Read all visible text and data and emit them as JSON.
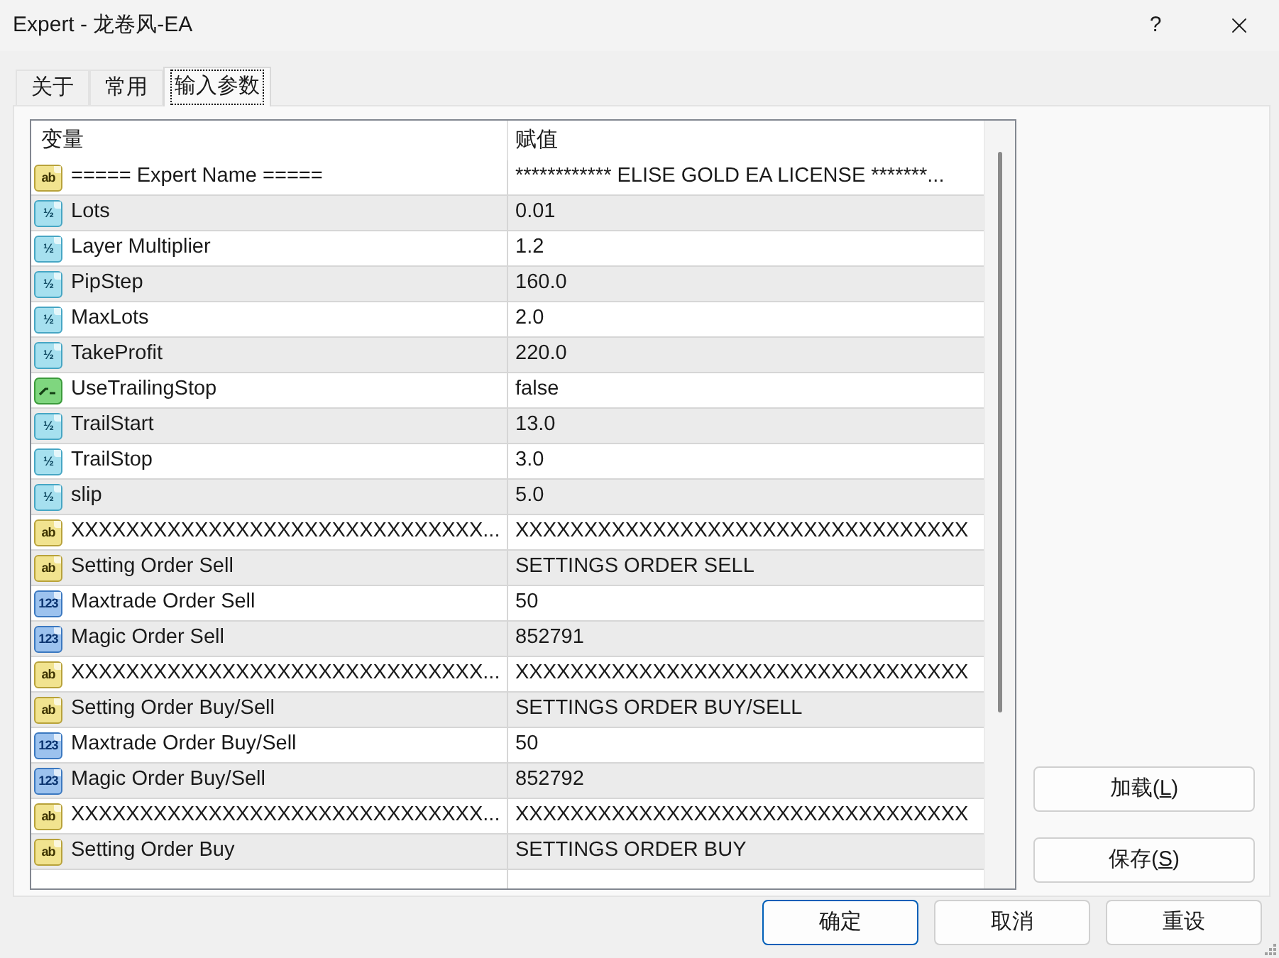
{
  "window": {
    "title": "Expert - 龙卷风-EA",
    "help_button": "?"
  },
  "tabs": [
    {
      "label": "关于",
      "selected": false
    },
    {
      "label": "常用",
      "selected": false
    },
    {
      "label": "输入参数",
      "selected": true
    }
  ],
  "parameters": {
    "columns": [
      "变量",
      "赋值"
    ],
    "rows": [
      {
        "kind": "string",
        "type_mark": "ab",
        "name": "===== Expert Name =====",
        "value": "************ ELISE GOLD EA LICENSE *******..."
      },
      {
        "kind": "double",
        "type_mark": "½",
        "name": "Lots",
        "value": "0.01"
      },
      {
        "kind": "double",
        "type_mark": "½",
        "name": "Layer Multiplier",
        "value": "1.2"
      },
      {
        "kind": "double",
        "type_mark": "½",
        "name": "PipStep",
        "value": "160.0"
      },
      {
        "kind": "double",
        "type_mark": "½",
        "name": "MaxLots",
        "value": "2.0"
      },
      {
        "kind": "double",
        "type_mark": "½",
        "name": "TakeProfit",
        "value": "220.0"
      },
      {
        "kind": "bool",
        "name": "UseTrailingStop",
        "value": "false"
      },
      {
        "kind": "double",
        "type_mark": "½",
        "name": "TrailStart",
        "value": "13.0"
      },
      {
        "kind": "double",
        "type_mark": "½",
        "name": "TrailStop",
        "value": "3.0"
      },
      {
        "kind": "double",
        "type_mark": "½",
        "name": "slip",
        "value": "5.0"
      },
      {
        "kind": "string",
        "type_mark": "ab",
        "name": "XXXXXXXXXXXXXXXXXXXXXXXXXXXXXX...",
        "value": "XXXXXXXXXXXXXXXXXXXXXXXXXXXXXXXXX"
      },
      {
        "kind": "string",
        "type_mark": "ab",
        "name": "Setting Order Sell",
        "value": "SETTINGS ORDER SELL"
      },
      {
        "kind": "integer",
        "type_mark": "123",
        "name": "Maxtrade Order Sell",
        "value": "50"
      },
      {
        "kind": "integer",
        "type_mark": "123",
        "name": "Magic Order Sell",
        "value": "852791"
      },
      {
        "kind": "string",
        "type_mark": "ab",
        "name": "XXXXXXXXXXXXXXXXXXXXXXXXXXXXXX...",
        "value": "XXXXXXXXXXXXXXXXXXXXXXXXXXXXXXXXX"
      },
      {
        "kind": "string",
        "type_mark": "ab",
        "name": "Setting Order Buy/Sell",
        "value": "SETTINGS ORDER BUY/SELL"
      },
      {
        "kind": "integer",
        "type_mark": "123",
        "name": "Maxtrade Order Buy/Sell",
        "value": "50"
      },
      {
        "kind": "integer",
        "type_mark": "123",
        "name": "Magic Order Buy/Sell",
        "value": "852792"
      },
      {
        "kind": "string",
        "type_mark": "ab",
        "name": "XXXXXXXXXXXXXXXXXXXXXXXXXXXXXX...",
        "value": "XXXXXXXXXXXXXXXXXXXXXXXXXXXXXXXXX"
      },
      {
        "kind": "string",
        "type_mark": "ab",
        "name": "Setting Order Buy",
        "value": "SETTINGS ORDER BUY"
      }
    ]
  },
  "side_buttons": [
    {
      "label": "加载(",
      "access_key": "L",
      "label_end": ")"
    },
    {
      "label": "保存(",
      "access_key": "S",
      "label_end": ")"
    }
  ],
  "buttons": [
    {
      "label": "确定",
      "default": true
    },
    {
      "label": "取消",
      "default": false
    },
    {
      "label": "重设",
      "default": false
    }
  ]
}
